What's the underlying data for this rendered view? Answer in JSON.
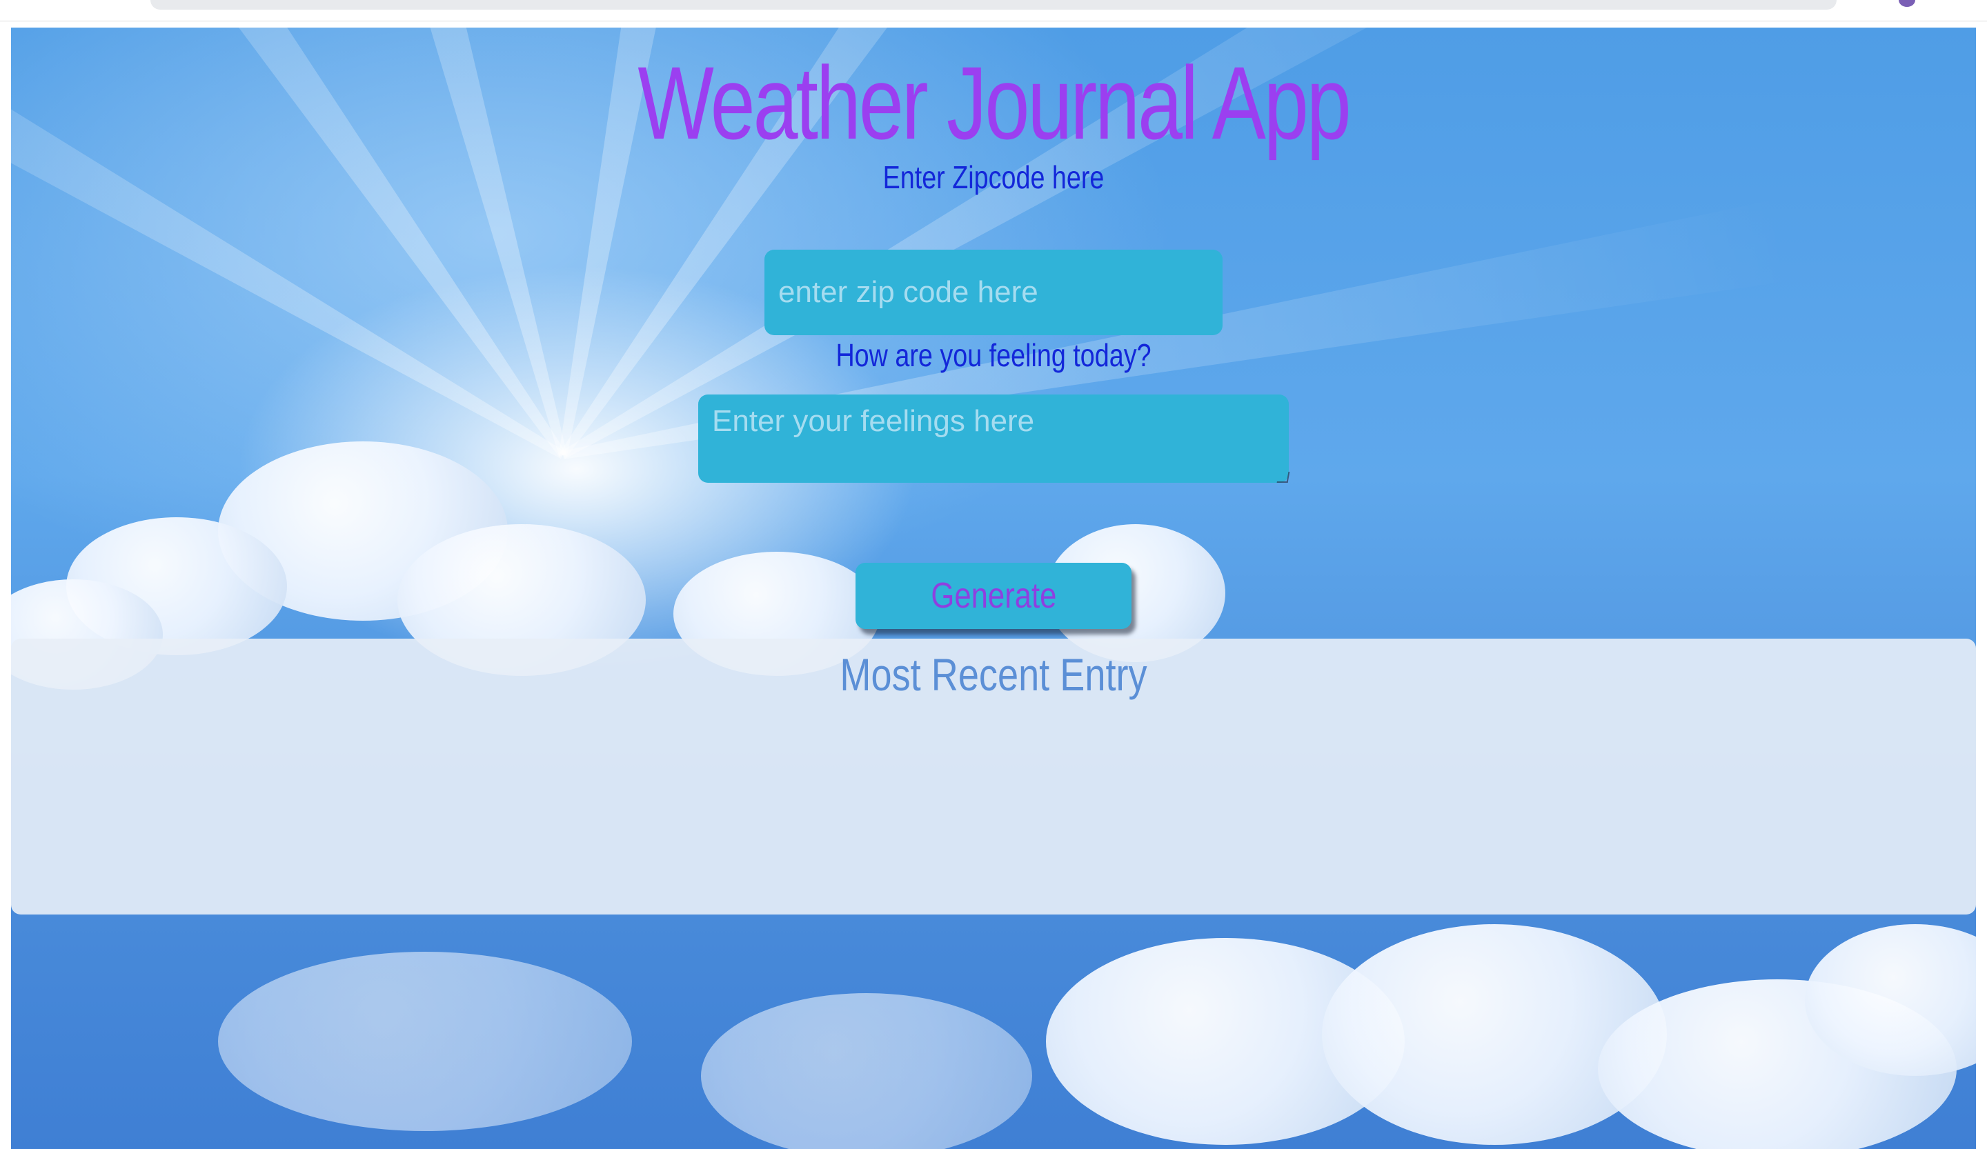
{
  "app": {
    "title": "Weather Journal App"
  },
  "form": {
    "zip_label": "Enter Zipcode here",
    "zip_placeholder": "enter zip code here",
    "feelings_label": "How are you feeling today?",
    "feelings_placeholder": "Enter your feelings here",
    "generate_label": "Generate"
  },
  "entry": {
    "title": "Most Recent Entry"
  },
  "colors": {
    "title": "#9b3ff0",
    "labels": "#1327d9",
    "input_bg": "#30b3d8",
    "entry_title": "#5b8fd6"
  }
}
